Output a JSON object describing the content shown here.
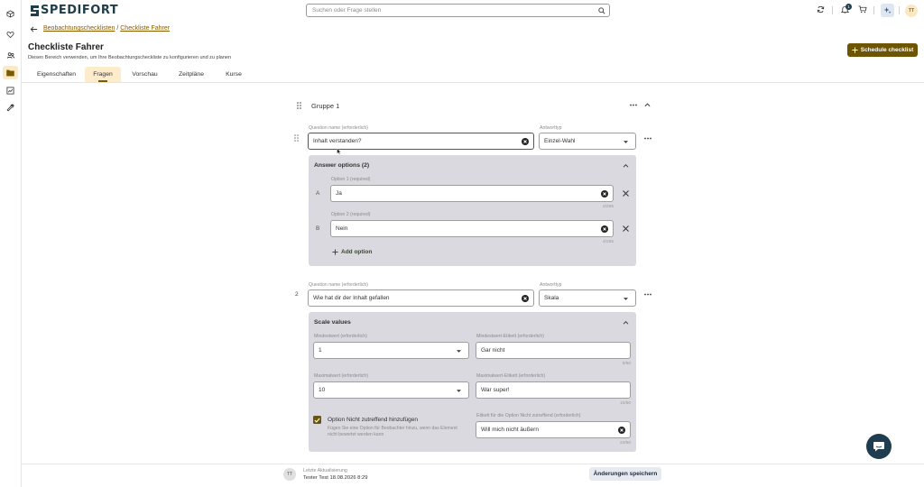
{
  "app": {
    "brand": "SPEDIFORT"
  },
  "header": {
    "search_placeholder": "Suchen oder Frage stellen",
    "notification_count": "1",
    "avatar_initials": "TT"
  },
  "breadcrumb": {
    "part1": "Beobachtungschecklisten",
    "separator": "/",
    "part2": "Checkliste Fahrer"
  },
  "page": {
    "title": "Checkliste Fahrer",
    "subtitle": "Diesen Bereich verwenden, um Ihre Beobachtungscheckliste zu konfigurieren und zu planen",
    "schedule_button": "Schedule checklist"
  },
  "tabs": [
    "Eigenschaften",
    "Fragen",
    "Vorschau",
    "Zeitpläne",
    "Kurse"
  ],
  "group": {
    "title": "Gruppe 1"
  },
  "question1": {
    "name_label": "Question name (erforderlich)",
    "name_value": "Inhalt verstanden?",
    "type_label": "Antworttyp",
    "type_value": "Einzel-Wahl",
    "options_title": "Answer options (2)",
    "options": [
      {
        "letter": "A",
        "label": "Option 1 (required)",
        "value": "Ja",
        "counter": "2/255"
      },
      {
        "letter": "B",
        "label": "Option 2 (required)",
        "value": "Nein",
        "counter": "4/255"
      }
    ],
    "add_option": "Add option"
  },
  "question2": {
    "number": "2",
    "name_label": "Question name (erforderlich)",
    "name_value": "Wie hat dir der Inhalt gefallen",
    "type_label": "Antworttyp",
    "type_value": "Skala",
    "scale_title": "Scale values",
    "min_label": "Mindestwert (erforderlich)",
    "min_value": "1",
    "min_text_label": "Mindestwert-Etikett (erforderlich)",
    "min_text_value": "Gar nicht",
    "min_text_counter": "9/50",
    "max_label": "Maximalwert (erforderlich)",
    "max_value": "10",
    "max_text_label": "Maximalwert-Etikett (erforderlich)",
    "max_text_value": "War super!",
    "max_text_counter": "10/50",
    "na_checkbox_label": "Option Nicht zutreffend hinzufügen",
    "na_checkbox_help": "Fügen Sie eine Option für Beobachter hinzu, wenn das Element nicht bewertet werden kann",
    "na_label": "Etikett für die Option Nicht zutreffend (erforderlich)",
    "na_value": "Will mich nicht äußern",
    "na_counter": "22/50"
  },
  "footer": {
    "avatar_initials": "TT",
    "last_update_label": "Letzte Aktualisierung",
    "last_update_value": "Tester Test 18.08.2026 8:29",
    "save_button": "Änderungen speichern"
  },
  "colors": {
    "accent": "#6e5503",
    "brand": "#1f3d4a",
    "panel": "#d9d9df",
    "tab_active_bg": "#fdeccb"
  }
}
